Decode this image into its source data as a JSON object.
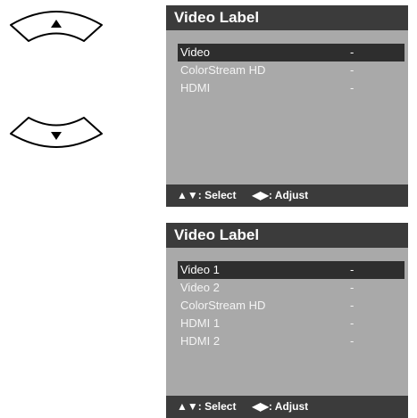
{
  "remote": {
    "up_icon": "arrow-up-icon",
    "down_icon": "arrow-down-icon"
  },
  "panel1": {
    "title": "Video Label",
    "items": [
      {
        "label": "Video",
        "value": "-",
        "selected": true
      },
      {
        "label": "ColorStream HD",
        "value": "-",
        "selected": false
      },
      {
        "label": "HDMI",
        "value": "-",
        "selected": false
      }
    ],
    "footer": {
      "select_glyph": "▲▼",
      "select_label": ": Select",
      "adjust_glyph": "◀▶",
      "adjust_label": ": Adjust"
    }
  },
  "panel2": {
    "title": "Video Label",
    "items": [
      {
        "label": "Video 1",
        "value": "-",
        "selected": true
      },
      {
        "label": "Video 2",
        "value": "-",
        "selected": false
      },
      {
        "label": "ColorStream HD",
        "value": "-",
        "selected": false
      },
      {
        "label": "HDMI 1",
        "value": "-",
        "selected": false
      },
      {
        "label": "HDMI 2",
        "value": "-",
        "selected": false
      }
    ],
    "footer": {
      "select_glyph": "▲▼",
      "select_label": ": Select",
      "adjust_glyph": "◀▶",
      "adjust_label": ": Adjust"
    }
  }
}
